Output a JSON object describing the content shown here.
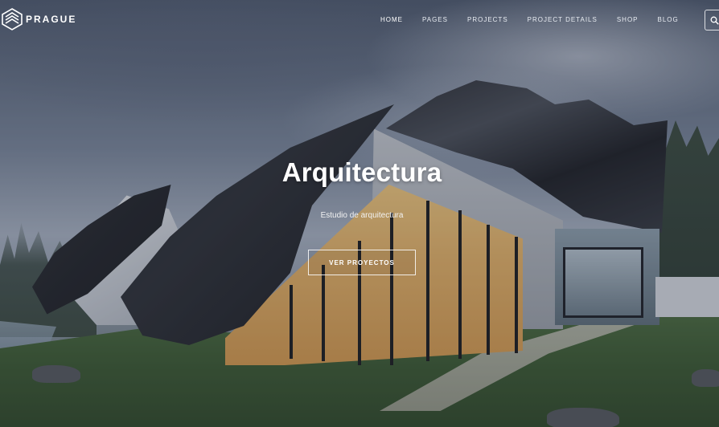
{
  "brand": {
    "name": "PRAGUE"
  },
  "nav": {
    "items": [
      {
        "label": "HOME",
        "active": true
      },
      {
        "label": "PAGES",
        "active": false
      },
      {
        "label": "PROJECTS",
        "active": false
      },
      {
        "label": "PROJECT DETAILS",
        "active": false
      },
      {
        "label": "SHOP",
        "active": false
      },
      {
        "label": "BLOG",
        "active": false
      }
    ],
    "search_icon": "search-icon"
  },
  "hero": {
    "title": "Arquitectura",
    "subtitle": "Estudio de arquitectura",
    "button_label": "VER PROYECTOS"
  },
  "colors": {
    "text": "#ffffff",
    "overlay": "#283044"
  }
}
